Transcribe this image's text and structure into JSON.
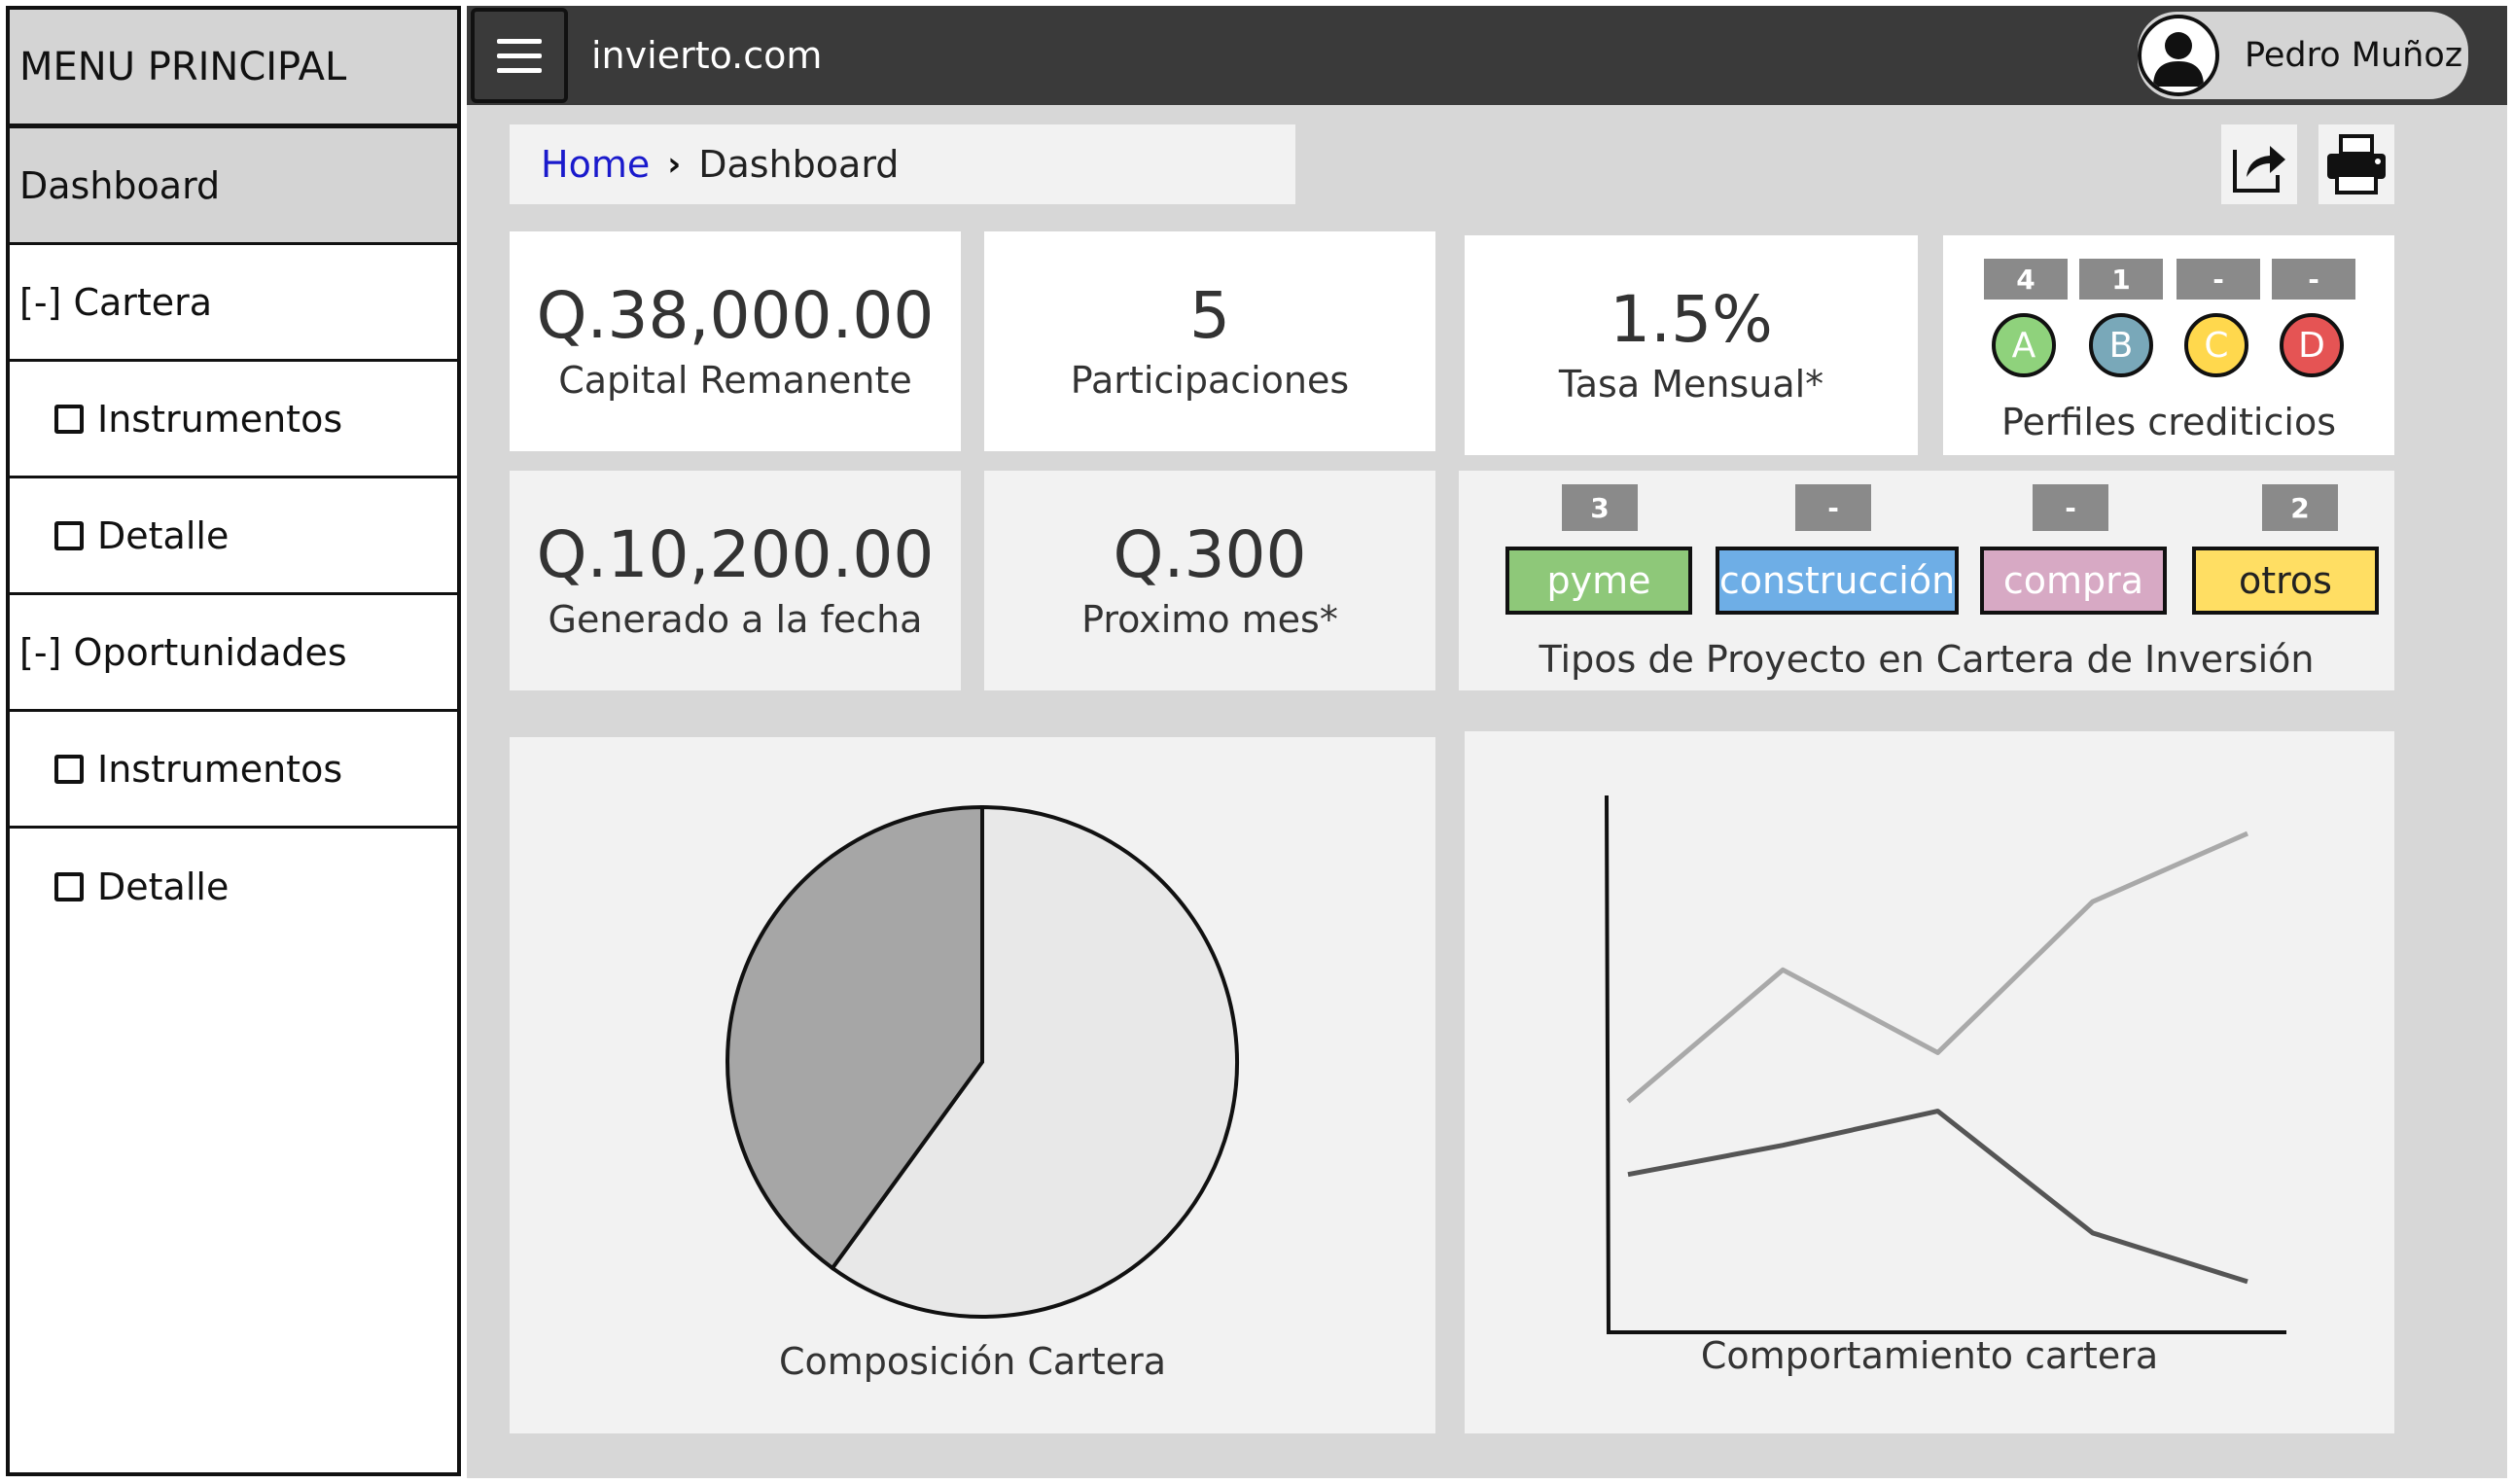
{
  "sidebar": {
    "title": "MENU PRINCIPAL",
    "items": [
      {
        "label": "Dashboard"
      },
      {
        "label": "[-] Cartera"
      },
      {
        "label": "Instrumentos"
      },
      {
        "label": "Detalle"
      },
      {
        "label": "[-] Oportunidades"
      },
      {
        "label": "Instrumentos"
      },
      {
        "label": "Detalle"
      }
    ]
  },
  "topbar": {
    "brand": "invierto.com",
    "user_name": "Pedro Muñoz"
  },
  "breadcrumb": {
    "home": "Home",
    "current": "Dashboard"
  },
  "stats": {
    "capital": {
      "value": "Q.38,000.00",
      "label": "Capital Remanente"
    },
    "participaciones": {
      "value": "5",
      "label": "Participaciones"
    },
    "tasa": {
      "value": "1.5%",
      "label": "Tasa Mensual*"
    },
    "generado": {
      "value": "Q.10,200.00",
      "label": "Generado a la fecha"
    },
    "proximo": {
      "value": "Q.300",
      "label": "Proximo mes*"
    }
  },
  "perfiles": {
    "label": "Perfiles crediticios",
    "grades": [
      {
        "letter": "A",
        "count": "4",
        "color": "#8fd27c"
      },
      {
        "letter": "B",
        "count": "1",
        "color": "#79a8b9"
      },
      {
        "letter": "C",
        "count": "-",
        "color": "#ffd84d"
      },
      {
        "letter": "D",
        "count": "-",
        "color": "#e55454"
      }
    ]
  },
  "tipos": {
    "label": "Tipos de Proyecto en Cartera de Inversión",
    "items": [
      {
        "name": "pyme",
        "count": "3",
        "color": "#8ec879"
      },
      {
        "name": "construcción",
        "count": "-",
        "color": "#6eaee6"
      },
      {
        "name": "compra",
        "count": "-",
        "color": "#d7a9c4"
      },
      {
        "name": "otros",
        "count": "2",
        "color": "#ffde63"
      }
    ]
  },
  "chart_data": [
    {
      "type": "pie",
      "title": "Composición Cartera",
      "slices": [
        {
          "value": 60,
          "color": "#e8e8e8"
        },
        {
          "value": 40,
          "color": "#a6a6a6"
        }
      ]
    },
    {
      "type": "line",
      "title": "Comportamiento cartera",
      "x": [
        0,
        1,
        2,
        3,
        4
      ],
      "grid": false,
      "series": [
        {
          "values": [
            0.45,
            0.72,
            0.55,
            0.86,
            1.0
          ],
          "color": "#a9a9a9"
        },
        {
          "values": [
            0.3,
            0.36,
            0.43,
            0.18,
            0.08
          ],
          "color": "#555555"
        }
      ],
      "ylim": [
        0,
        1.05
      ]
    }
  ]
}
